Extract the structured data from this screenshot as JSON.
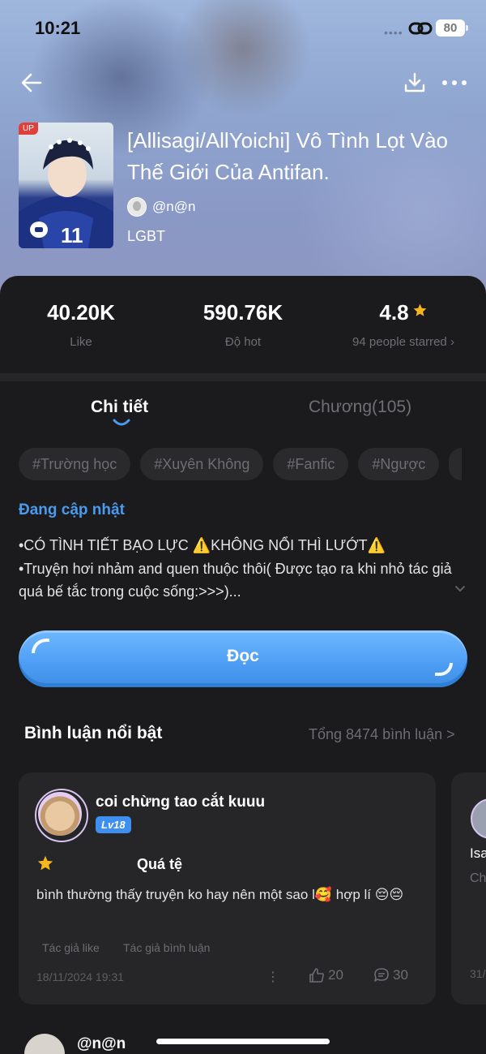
{
  "status_bar": {
    "time": "10:21",
    "signal": "••••",
    "battery": "80"
  },
  "header": {
    "up_badge": "UP",
    "title": "[Allisagi/AllYoichi] Vô Tình Lọt Vào Thế Giới Của Antifan.",
    "author": "@n@n",
    "genre": "LGBT"
  },
  "stats": [
    {
      "value": "40.20K",
      "label": "Like"
    },
    {
      "value": "590.76K",
      "label": "Độ hot"
    },
    {
      "value": "4.8",
      "label": "94 people starred  ›"
    }
  ],
  "tabs": {
    "detail": "Chi tiết",
    "chapters": "Chương(105)"
  },
  "tags": [
    "#Trường học",
    "#Xuyên Không",
    "#Fanfic",
    "#Ngược"
  ],
  "update_status": "Đang cập nhật",
  "description": {
    "line1": "•CÓ TÌNH TIẾT BẠO LỰC ⚠️KHÔNG NỔI THÌ LƯỚT⚠️",
    "line2": "•Truyện hơi nhảm and quen thuộc thôi( Được tạo ra khi nhỏ tác giả quá bế tắc trong cuộc sống:>>>)..."
  },
  "read_button": "Đọc",
  "comments_section": {
    "title": "Bình luận nổi bật",
    "total": "Tổng 8474 bình luận >"
  },
  "comment": {
    "user": "coi chừng tao cắt kuuu",
    "level": "Lv18",
    "rating_text": "Quá tệ",
    "text": "bình thường thấy truyện ko hay nên một sao l🥰 hợp lí 😔😔",
    "tag_author_like": "Tác giả like",
    "tag_author_comment": "Tác giả bình luận",
    "date": "18/11/2024 19:31",
    "dots": "⋮",
    "likes": "20",
    "replies": "30"
  },
  "next_comment": {
    "name": "Isa",
    "sub": "Ch",
    "date": "31/"
  },
  "bottom_comment": {
    "user": "@n@n"
  },
  "colors": {
    "accent": "#4a9bef",
    "background": "#1b1b1d",
    "card": "#262628",
    "star": "#f6b61c"
  }
}
